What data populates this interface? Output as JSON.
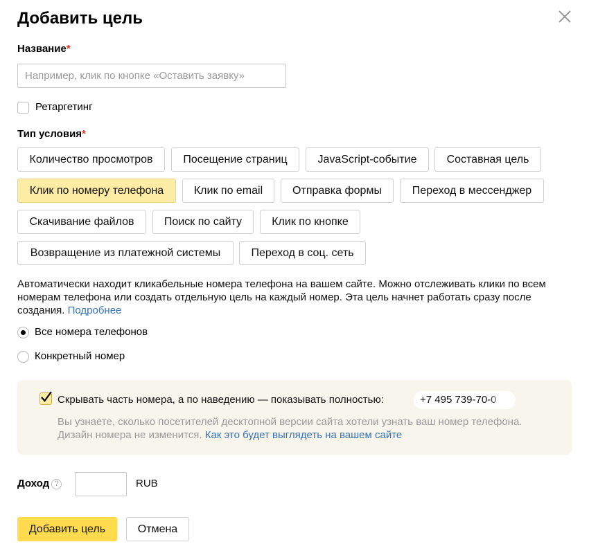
{
  "dialog": {
    "title": "Добавить цель",
    "close_icon": "close-icon"
  },
  "name_field": {
    "label": "Название",
    "required_mark": "*",
    "placeholder": "Например, клик по кнопке «Оставить заявку»",
    "value": ""
  },
  "retargeting": {
    "label": "Ретаргетинг",
    "checked": false
  },
  "condition_type": {
    "label": "Тип условия",
    "required_mark": "*",
    "options": [
      {
        "label": "Количество просмотров",
        "active": false
      },
      {
        "label": "Посещение страниц",
        "active": false
      },
      {
        "label": "JavaScript-событие",
        "active": false
      },
      {
        "label": "Составная цель",
        "active": false
      },
      {
        "label": "Клик по номеру телефона",
        "active": true
      },
      {
        "label": "Клик по email",
        "active": false
      },
      {
        "label": "Отправка формы",
        "active": false
      },
      {
        "label": "Переход в мессенджер",
        "active": false
      },
      {
        "label": "Скачивание файлов",
        "active": false
      },
      {
        "label": "Поиск по сайту",
        "active": false
      },
      {
        "label": "Клик по кнопке",
        "active": false
      },
      {
        "label": "Возвращение из платежной системы",
        "active": false
      },
      {
        "label": "Переход в соц. сеть",
        "active": false
      }
    ]
  },
  "description": {
    "text": "Автоматически находит кликабельные номера телефона на вашем сайте. Можно отслеживать клики по всем номерам телефона или создать отдельную цель на каждый номер. Эта цель начнет работать сразу после создания. ",
    "link": "Подробнее"
  },
  "phone_scope": {
    "options": [
      {
        "label": "Все номера телефонов",
        "selected": true
      },
      {
        "label": "Конкретный номер",
        "selected": false
      }
    ]
  },
  "hide_number": {
    "checked": true,
    "label": "Скрывать часть номера, а по наведению — показывать полностью:",
    "example": "+7 495 739-70-0",
    "hint": "Вы узнаете, сколько посетителей десктопной версии сайта хотели узнать ваш номер телефона. Дизайн номера не изменится. ",
    "hint_link": "Как это будет выглядеть на вашем сайте"
  },
  "income": {
    "label": "Доход",
    "help_icon": "help-icon",
    "help_glyph": "?",
    "value": "",
    "currency": "RUB"
  },
  "actions": {
    "submit": "Добавить цель",
    "cancel": "Отмена"
  }
}
